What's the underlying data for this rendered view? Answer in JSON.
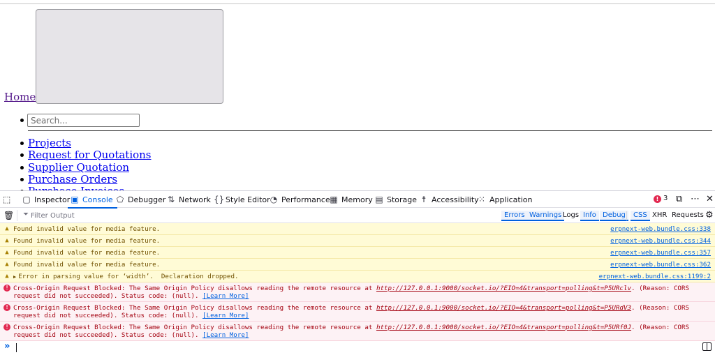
{
  "page": {
    "home_link": "Home",
    "search_placeholder": "Search...",
    "menu": [
      "Projects",
      "Request for Quotations",
      "Supplier Quotation",
      "Purchase Orders",
      "Purchase Invoices"
    ]
  },
  "devtools": {
    "tabs": [
      {
        "label": "Inspector",
        "icon": "inspector-icon"
      },
      {
        "label": "Console",
        "icon": "console-icon"
      },
      {
        "label": "Debugger",
        "icon": "debugger-icon"
      },
      {
        "label": "Network",
        "icon": "network-icon"
      },
      {
        "label": "Style Editor",
        "icon": "style-editor-icon"
      },
      {
        "label": "Performance",
        "icon": "performance-icon"
      },
      {
        "label": "Memory",
        "icon": "memory-icon"
      },
      {
        "label": "Storage",
        "icon": "storage-icon"
      },
      {
        "label": "Accessibility",
        "icon": "accessibility-icon"
      },
      {
        "label": "Application",
        "icon": "application-icon"
      }
    ],
    "selected_tab": "Console",
    "error_count": "3",
    "filter_placeholder": "Filter Output",
    "filters": {
      "errors": "Errors",
      "warnings": "Warnings",
      "logs": "Logs",
      "info": "Info",
      "debug": "Debug",
      "css": "CSS",
      "xhr": "XHR",
      "requests": "Requests"
    },
    "messages": [
      {
        "level": "warning",
        "text": "Found invalid value for media feature.",
        "source": "erpnext-web.bundle.css:338"
      },
      {
        "level": "warning",
        "text": "Found invalid value for media feature.",
        "source": "erpnext-web.bundle.css:344"
      },
      {
        "level": "warning",
        "text": "Found invalid value for media feature.",
        "source": "erpnext-web.bundle.css:357"
      },
      {
        "level": "warning",
        "text": "Found invalid value for media feature.",
        "source": "erpnext-web.bundle.css:362"
      },
      {
        "level": "warning",
        "text": "Error in parsing value for ‘width’.  Declaration dropped.",
        "source": "erpnext-web.bundle.css:1199:2"
      },
      {
        "level": "error",
        "prefix": "Cross-Origin Request Blocked: The Same Origin Policy disallows reading the remote resource at ",
        "url": "http://127.0.0.1:9000/socket.io/?EIO=4&transport=polling&t=P5URclv",
        "suffix": ". (Reason: CORS request did not succeeded). Status code: (null). ",
        "learn": "[Learn More]"
      },
      {
        "level": "error",
        "prefix": "Cross-Origin Request Blocked: The Same Origin Policy disallows reading the remote resource at ",
        "url": "http://127.0.0.1:9000/socket.io/?EIO=4&transport=polling&t=P5URdV3",
        "suffix": ". (Reason: CORS request did not succeeded). Status code: (null). ",
        "learn": "[Learn More]"
      },
      {
        "level": "error",
        "prefix": "Cross-Origin Request Blocked: The Same Origin Policy disallows reading the remote resource at ",
        "url": "http://127.0.0.1:9000/socket.io/?EIO=4&transport=polling&t=P5URf0J",
        "suffix": ". (Reason: CORS request did not succeeded). Status code: (null). ",
        "learn": "[Learn More]"
      }
    ]
  }
}
